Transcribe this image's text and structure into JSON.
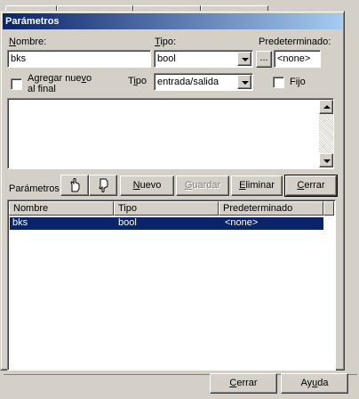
{
  "dialog": {
    "title": "Parámetros",
    "nombre_label": "Nombre:",
    "nombre_value": "bks",
    "tipo_label": "Tipo:",
    "tipo_value": "bool",
    "browse_label": "...",
    "predeterminado_label": "Predeterminado:",
    "predeterminado_value": "<none>",
    "agregar_label_1": "Agregar nuevo",
    "agregar_label_2": "al final",
    "direccion_label": "Tipo",
    "direccion_value": "entrada/salida",
    "fijo_label": "Fijo",
    "parametros_label": "Parámetros",
    "buttons": {
      "nuevo": "Nuevo",
      "guardar": "Guardar",
      "eliminar": "Eliminar",
      "cerrar": "Cerrar"
    },
    "table": {
      "columns": [
        "Nombre",
        "Tipo",
        "Predeterminado"
      ],
      "rows": [
        {
          "nombre": "bks",
          "tipo": "bool",
          "predeterminado": "<none>"
        }
      ]
    }
  },
  "footer": {
    "cerrar": "Cerrar",
    "ayuda": "Ayuda"
  },
  "colors": {
    "title_bar_start": "#0a246a",
    "title_bar_end": "#a6caf0",
    "selection": "#0a246a",
    "face": "#d4d0c8"
  }
}
